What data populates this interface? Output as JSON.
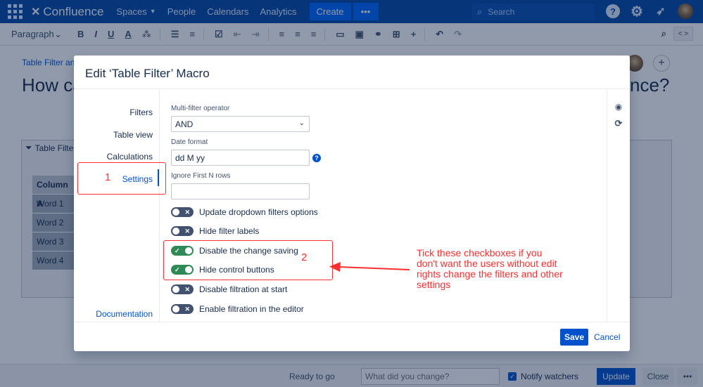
{
  "topnav": {
    "brand": "Confluence",
    "links": [
      "Spaces",
      "People",
      "Calendars",
      "Analytics"
    ],
    "create_label": "Create",
    "more_label": "•••",
    "search_placeholder": "Search",
    "help_glyph": "?"
  },
  "toolbar": {
    "paragraph_label": "Paragraph",
    "bold": "B",
    "italic": "I",
    "underline": "U",
    "text_color": "A",
    "code_label": "< >"
  },
  "page": {
    "breadcrumb": "Table Filter and",
    "title_left": "How ca",
    "title_right": "nce?",
    "macro_label": "Table Filte",
    "table": {
      "header": "Column A",
      "rows": [
        "Word 1",
        "Word 2",
        "Word 3",
        "Word 4"
      ]
    }
  },
  "dialog": {
    "title": "Edit ‘Table Filter’ Macro",
    "side_items": [
      "Filters",
      "Table view",
      "Calculations",
      "Settings"
    ],
    "documentation": "Documentation",
    "fields": {
      "multi_filter_label": "Multi-filter operator",
      "multi_filter_value": "AND",
      "date_format_label": "Date format",
      "date_format_value": "dd M yy",
      "ignore_rows_label": "Ignore First N rows",
      "ignore_rows_value": ""
    },
    "toggles": [
      {
        "label": "Update dropdown filters options",
        "on": false
      },
      {
        "label": "Hide filter labels",
        "on": false
      },
      {
        "label": "Disable the change saving",
        "on": true
      },
      {
        "label": "Hide control buttons",
        "on": true
      },
      {
        "label": "Disable filtration at start",
        "on": false
      },
      {
        "label": "Enable filtration in the editor",
        "on": false
      }
    ],
    "save_label": "Save",
    "cancel_label": "Cancel"
  },
  "bottombar": {
    "status": "Ready to go",
    "change_placeholder": "What did you change?",
    "notify_label": "Notify watchers",
    "update_label": "Update",
    "close_label": "Close",
    "more_label": "•••"
  },
  "annotations": {
    "marker_1": "1",
    "marker_2": "2",
    "note": "Tick these checkboxes if you don't want the users without edit rights change the filters and other settings"
  },
  "colors": {
    "nav_bg": "#0747a6",
    "primary": "#0052cc",
    "toggle_on": "#2e8b57",
    "toggle_off": "#42526e",
    "annotation": "#ff2d2d"
  }
}
